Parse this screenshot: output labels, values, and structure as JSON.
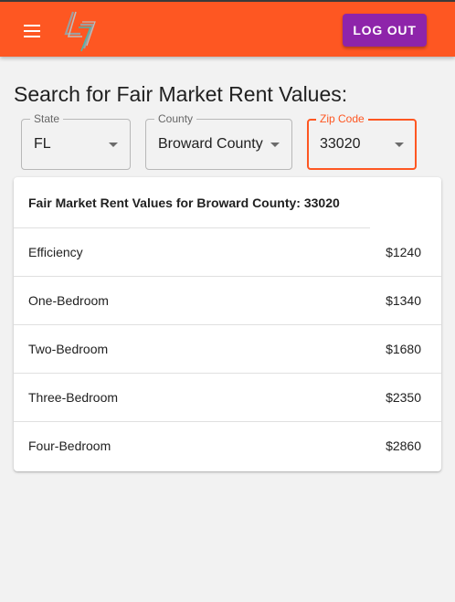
{
  "header": {
    "menu_icon": "hamburger-menu-icon",
    "logo_icon": "brand-logo-icon",
    "logout_label": "LOG OUT",
    "colors": {
      "appbar": "#fe5722",
      "logout_button": "#8e24aa"
    }
  },
  "search": {
    "heading": "Search for Fair Market Rent Values:",
    "fields": [
      {
        "label": "State",
        "value": "FL"
      },
      {
        "label": "County",
        "value": "Broward County"
      },
      {
        "label": "Zip Code",
        "value": "33020"
      }
    ]
  },
  "results": {
    "title": "Fair Market Rent Values for Broward County: 33020",
    "rows": [
      {
        "label": "Efficiency",
        "value": "$1240"
      },
      {
        "label": "One-Bedroom",
        "value": "$1340"
      },
      {
        "label": "Two-Bedroom",
        "value": "$1680"
      },
      {
        "label": "Three-Bedroom",
        "value": "$2350"
      },
      {
        "label": "Four-Bedroom",
        "value": "$2860"
      }
    ]
  }
}
